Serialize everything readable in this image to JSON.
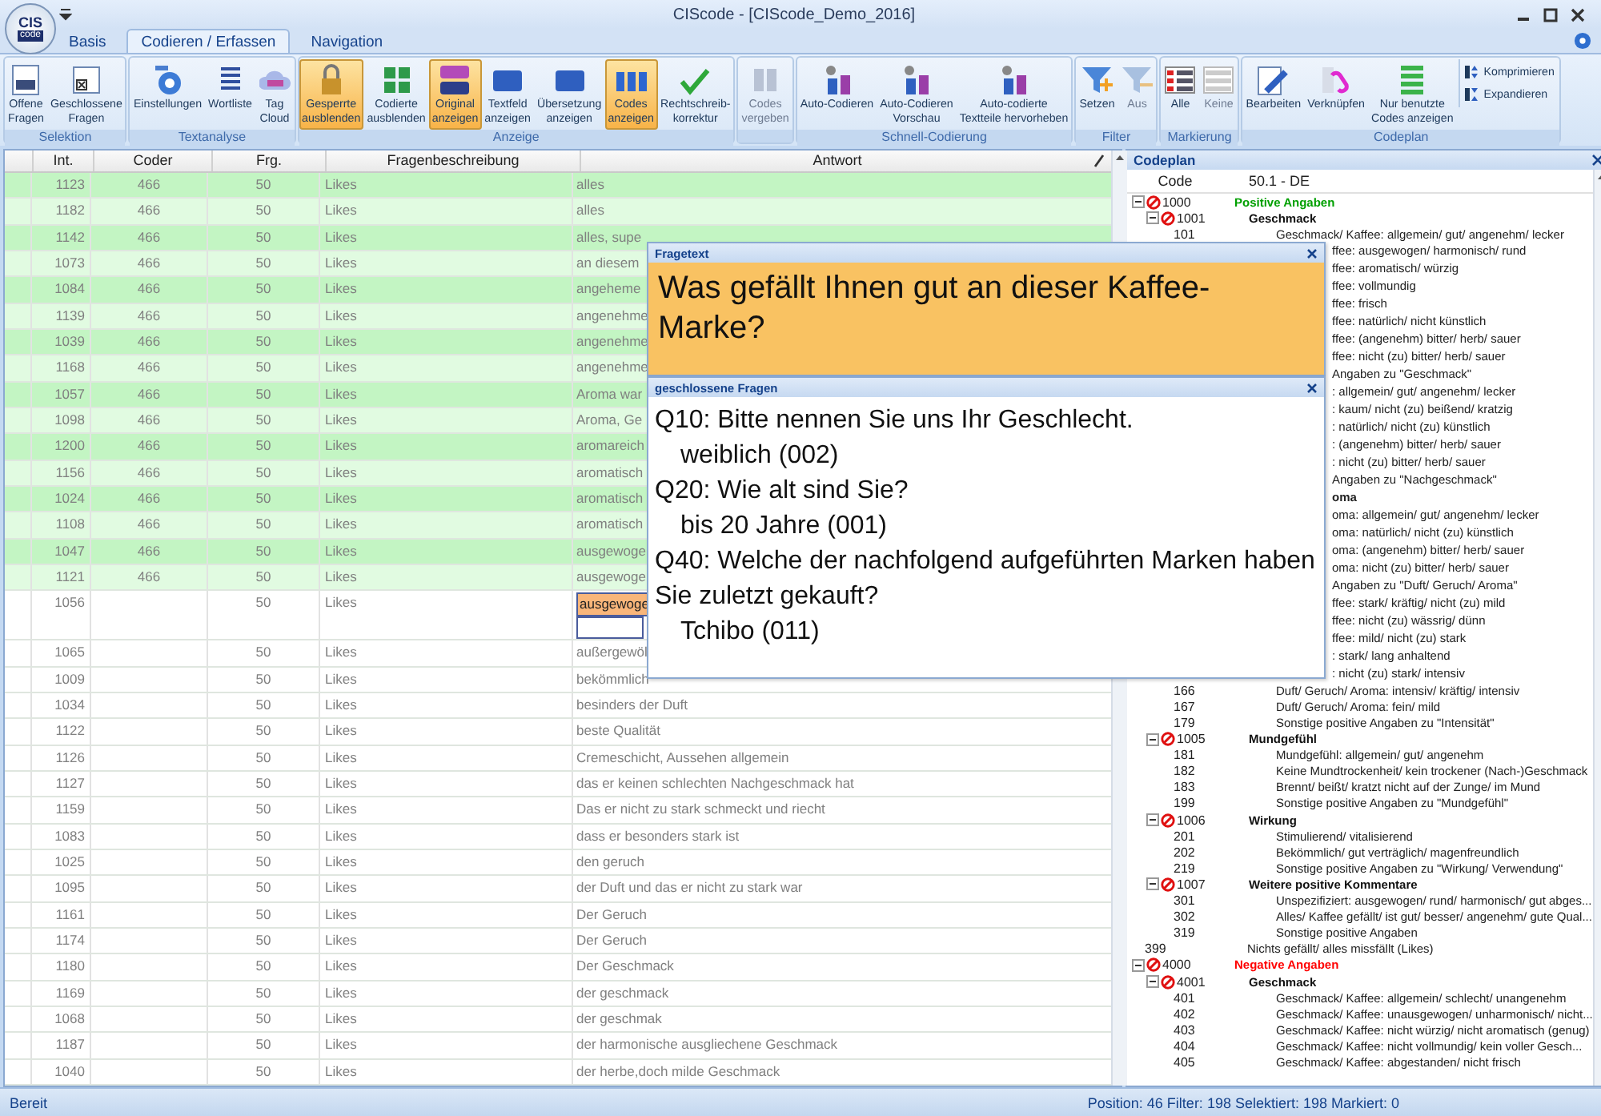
{
  "window": {
    "title": "CIScode - [CIScode_Demo_2016]",
    "logo": [
      "CIS",
      "code"
    ]
  },
  "tabs": [
    {
      "label": "Basis",
      "selected": false
    },
    {
      "label": "Codieren / Erfassen",
      "selected": true
    },
    {
      "label": "Navigation",
      "selected": false
    }
  ],
  "ribbon": [
    {
      "label": "Selektion",
      "buttons": [
        {
          "label": "Offene\nFragen",
          "active": false,
          "disabled": false
        },
        {
          "label": "Geschlossene\nFragen",
          "active": false,
          "disabled": false
        }
      ]
    },
    {
      "label": "Textanalyse",
      "buttons": [
        {
          "label": "Einstellungen",
          "active": false,
          "disabled": false
        },
        {
          "label": "Wortliste",
          "active": false,
          "disabled": false
        },
        {
          "label": "Tag\nCloud",
          "active": false,
          "disabled": false
        }
      ]
    },
    {
      "label": "Anzeige",
      "buttons": [
        {
          "label": "Gesperrte\nausblenden",
          "active": true,
          "disabled": false
        },
        {
          "label": "Codierte\nausblenden",
          "active": false,
          "disabled": false
        },
        {
          "label": "Original\nanzeigen",
          "active": true,
          "disabled": false
        },
        {
          "label": "Textfeld\nanzeigen",
          "active": false,
          "disabled": false
        },
        {
          "label": "Übersetzung\nanzeigen",
          "active": false,
          "disabled": false
        },
        {
          "label": "Codes\nanzeigen",
          "active": true,
          "disabled": false
        },
        {
          "label": "Rechtschreib-\nkorrektur",
          "active": false,
          "disabled": false
        }
      ]
    },
    {
      "buttons": [
        {
          "label": "Codes\nvergeben",
          "active": false,
          "disabled": true
        }
      ]
    },
    {
      "label": "Schnell-Codierung",
      "buttons": [
        {
          "label": "Auto-Codieren",
          "active": false,
          "disabled": false
        },
        {
          "label": "Auto-Codieren\nVorschau",
          "active": false,
          "disabled": false
        },
        {
          "label": "Auto-codierte\nTextteile hervorheben",
          "active": false,
          "disabled": false
        }
      ]
    },
    {
      "label": "Filter",
      "buttons": [
        {
          "label": "Setzen",
          "active": false,
          "disabled": false
        },
        {
          "label": "Aus",
          "active": false,
          "disabled": true
        }
      ]
    },
    {
      "label": "Markierung",
      "buttons": [
        {
          "label": "Alle",
          "active": false,
          "disabled": false
        },
        {
          "label": "Keine",
          "active": false,
          "disabled": true
        }
      ]
    },
    {
      "label": "Codeplan",
      "buttons": [
        {
          "label": "Bearbeiten",
          "active": false,
          "disabled": false
        },
        {
          "label": "Verknüpfen",
          "active": false,
          "disabled": false
        },
        {
          "label": "Nur benutzte\nCodes anzeigen",
          "active": false,
          "disabled": false
        }
      ],
      "small_buttons": [
        "Komprimieren",
        "Expandieren"
      ]
    }
  ],
  "table": {
    "columns": [
      "Int.",
      "Coder",
      "Frg.",
      "Fragenbeschreibung",
      "Antwort"
    ],
    "rows": [
      {
        "int": "1123",
        "coder": "466",
        "frg": "50",
        "desc": "Likes",
        "answer": "alles",
        "coded": true,
        "editing": false
      },
      {
        "int": "1182",
        "coder": "466",
        "frg": "50",
        "desc": "Likes",
        "answer": "alles",
        "coded": true,
        "editing": false
      },
      {
        "int": "1142",
        "coder": "466",
        "frg": "50",
        "desc": "Likes",
        "answer": "alles, supe",
        "coded": true,
        "editing": false
      },
      {
        "int": "1073",
        "coder": "466",
        "frg": "50",
        "desc": "Likes",
        "answer": "an diesem",
        "coded": true,
        "editing": false
      },
      {
        "int": "1084",
        "coder": "466",
        "frg": "50",
        "desc": "Likes",
        "answer": "angeheme",
        "coded": true,
        "editing": false
      },
      {
        "int": "1139",
        "coder": "466",
        "frg": "50",
        "desc": "Likes",
        "answer": "angenehme",
        "coded": true,
        "editing": false
      },
      {
        "int": "1039",
        "coder": "466",
        "frg": "50",
        "desc": "Likes",
        "answer": "angenehme",
        "coded": true,
        "editing": false
      },
      {
        "int": "1168",
        "coder": "466",
        "frg": "50",
        "desc": "Likes",
        "answer": "angenehme",
        "coded": true,
        "editing": false
      },
      {
        "int": "1057",
        "coder": "466",
        "frg": "50",
        "desc": "Likes",
        "answer": "Aroma war",
        "coded": true,
        "editing": false
      },
      {
        "int": "1098",
        "coder": "466",
        "frg": "50",
        "desc": "Likes",
        "answer": "Aroma, Ge",
        "coded": true,
        "editing": false
      },
      {
        "int": "1200",
        "coder": "466",
        "frg": "50",
        "desc": "Likes",
        "answer": "aromareich",
        "coded": true,
        "editing": false
      },
      {
        "int": "1156",
        "coder": "466",
        "frg": "50",
        "desc": "Likes",
        "answer": "aromatisch",
        "coded": true,
        "editing": false
      },
      {
        "int": "1024",
        "coder": "466",
        "frg": "50",
        "desc": "Likes",
        "answer": "aromatisch",
        "coded": true,
        "editing": false
      },
      {
        "int": "1108",
        "coder": "466",
        "frg": "50",
        "desc": "Likes",
        "answer": "aromatisch",
        "coded": true,
        "editing": false
      },
      {
        "int": "1047",
        "coder": "466",
        "frg": "50",
        "desc": "Likes",
        "answer": "ausgewoge",
        "coded": true,
        "editing": false
      },
      {
        "int": "1121",
        "coder": "466",
        "frg": "50",
        "desc": "Likes",
        "answer": "ausgewoge",
        "coded": true,
        "editing": false
      },
      {
        "int": "1056",
        "frg": "50",
        "desc": "Likes",
        "answer": "ausgewoge",
        "coded": false,
        "editing": true
      },
      {
        "int": "1065",
        "frg": "50",
        "desc": "Likes",
        "answer": "außergewöl",
        "coded": false,
        "editing": false
      },
      {
        "int": "1009",
        "frg": "50",
        "desc": "Likes",
        "answer": "bekömmlich",
        "coded": false,
        "editing": false
      },
      {
        "int": "1034",
        "frg": "50",
        "desc": "Likes",
        "answer": "besinders der Duft",
        "coded": false,
        "editing": false
      },
      {
        "int": "1122",
        "frg": "50",
        "desc": "Likes",
        "answer": "beste Qualität",
        "coded": false,
        "editing": false
      },
      {
        "int": "1126",
        "frg": "50",
        "desc": "Likes",
        "answer": "Cremeschicht, Aussehen allgemein",
        "coded": false,
        "editing": false
      },
      {
        "int": "1127",
        "frg": "50",
        "desc": "Likes",
        "answer": "das er keinen schlechten Nachgeschmack hat",
        "coded": false,
        "editing": false
      },
      {
        "int": "1159",
        "frg": "50",
        "desc": "Likes",
        "answer": "Das er nicht zu stark schmeckt und riecht",
        "coded": false,
        "editing": false
      },
      {
        "int": "1083",
        "frg": "50",
        "desc": "Likes",
        "answer": "dass er besonders stark ist",
        "coded": false,
        "editing": false
      },
      {
        "int": "1025",
        "frg": "50",
        "desc": "Likes",
        "answer": "den geruch",
        "coded": false,
        "editing": false
      },
      {
        "int": "1095",
        "frg": "50",
        "desc": "Likes",
        "answer": "der Duft und das er nicht zu stark war",
        "coded": false,
        "editing": false
      },
      {
        "int": "1161",
        "frg": "50",
        "desc": "Likes",
        "answer": "Der Geruch",
        "coded": false,
        "editing": false
      },
      {
        "int": "1174",
        "frg": "50",
        "desc": "Likes",
        "answer": "Der Geruch",
        "coded": false,
        "editing": false
      },
      {
        "int": "1180",
        "frg": "50",
        "desc": "Likes",
        "answer": "Der Geschmack",
        "coded": false,
        "editing": false
      },
      {
        "int": "1169",
        "frg": "50",
        "desc": "Likes",
        "answer": "der geschmack",
        "coded": false,
        "editing": false
      },
      {
        "int": "1068",
        "frg": "50",
        "desc": "Likes",
        "answer": "der geschmak",
        "coded": false,
        "editing": false
      },
      {
        "int": "1187",
        "frg": "50",
        "desc": "Likes",
        "answer": "der harmonische ausgliechene Geschmack",
        "coded": false,
        "editing": false
      },
      {
        "int": "1040",
        "frg": "50",
        "desc": "Likes",
        "answer": "der herbe,doch milde Geschmack",
        "coded": false,
        "editing": false
      }
    ]
  },
  "fragetext": {
    "title": "Fragetext",
    "text": "Was gefällt Ihnen gut an dieser Kaffee-Marke?"
  },
  "closed_questions": {
    "title": "geschlossene Fragen",
    "questions": [
      {
        "text": "Q10: Bitte nennen Sie uns Ihr Geschlecht.",
        "answers": [
          "weiblich (002)"
        ]
      },
      {
        "text": "Q20: Wie alt sind Sie?",
        "answers": [
          "bis 20 Jahre (001)"
        ]
      },
      {
        "text": "Q40: Welche der nachfolgend aufgeführten Marken haben Sie zuletzt gekauft?",
        "answers": [
          "Tchibo (011)"
        ]
      }
    ]
  },
  "codeplan": {
    "title": "Codeplan",
    "columns": [
      "Code",
      "50.1 - DE"
    ],
    "nodes": [
      {
        "kind": "group",
        "code": "1000",
        "label": "Positive Angaben",
        "color": "#00a000",
        "expanded": true,
        "children": [
          {
            "kind": "group",
            "code": "1001",
            "label": "Geschmack",
            "expanded": true,
            "children": [
              {
                "kind": "item",
                "code": "101",
                "label": "Geschmack/ Kaffee: allgemein/ gut/ angenehm/ lecker"
              },
              {
                "kind": "fragment",
                "label": "ffee: ausgewogen/ harmonisch/ rund"
              },
              {
                "kind": "fragment",
                "label": "ffee: aromatisch/ würzig"
              },
              {
                "kind": "fragment",
                "label": "ffee: vollmundig"
              },
              {
                "kind": "fragment",
                "label": "ffee: frisch"
              },
              {
                "kind": "fragment",
                "label": "ffee: natürlich/ nicht künstlich"
              },
              {
                "kind": "fragment",
                "label": "ffee: (angenehm) bitter/ herb/ sauer"
              },
              {
                "kind": "fragment",
                "label": "ffee: nicht (zu) bitter/ herb/ sauer"
              },
              {
                "kind": "fragment",
                "label": "Angaben zu \"Geschmack\""
              }
            ]
          },
          {
            "kind": "fragment",
            "label": ": allgemein/ gut/ angenehm/ lecker"
          },
          {
            "kind": "fragment",
            "label": ": kaum/ nicht (zu) beißend/ kratzig"
          },
          {
            "kind": "fragment",
            "label": ": natürlich/ nicht (zu) künstlich"
          },
          {
            "kind": "fragment",
            "label": ": (angenehm) bitter/ herb/ sauer"
          },
          {
            "kind": "fragment",
            "label": ": nicht (zu) bitter/ herb/ sauer"
          },
          {
            "kind": "fragment",
            "label": "Angaben zu \"Nachgeschmack\""
          },
          {
            "kind": "fragment_heading",
            "label": "oma"
          },
          {
            "kind": "fragment",
            "label": "oma: allgemein/ gut/ angenehm/ lecker"
          },
          {
            "kind": "fragment",
            "label": "oma: natürlich/ nicht (zu) künstlich"
          },
          {
            "kind": "fragment",
            "label": "oma: (angenehm) bitter/ herb/ sauer"
          },
          {
            "kind": "fragment",
            "label": "oma: nicht (zu) bitter/ herb/ sauer"
          },
          {
            "kind": "fragment",
            "label": "Angaben zu \"Duft/ Geruch/ Aroma\""
          },
          {
            "kind": "fragment",
            "label": "ffee: stark/ kräftig/ nicht (zu) mild"
          },
          {
            "kind": "fragment",
            "label": "ffee: nicht (zu) wässrig/ dünn"
          },
          {
            "kind": "fragment",
            "label": "ffee: mild/ nicht (zu) stark"
          },
          {
            "kind": "fragment",
            "label": ": stark/ lang anhaltend"
          },
          {
            "kind": "fragment",
            "label": ": nicht (zu) stark/ intensiv"
          },
          {
            "kind": "item",
            "code": "166",
            "label": "Duft/ Geruch/ Aroma: intensiv/ kräftig/ intensiv"
          },
          {
            "kind": "item",
            "code": "167",
            "label": "Duft/ Geruch/ Aroma: fein/ mild"
          },
          {
            "kind": "item",
            "code": "179",
            "label": "Sonstige positive Angaben zu \"Intensität\""
          },
          {
            "kind": "group",
            "code": "1005",
            "label": "Mundgefühl",
            "expanded": true,
            "children": [
              {
                "kind": "item",
                "code": "181",
                "label": "Mundgefühl: allgemein/ gut/ angenehm"
              },
              {
                "kind": "item",
                "code": "182",
                "label": "Keine Mundtrockenheit/ kein trockener (Nach-)Geschmack"
              },
              {
                "kind": "item",
                "code": "183",
                "label": "Brennt/ beißt/ kratzt nicht auf der Zunge/ im Mund"
              },
              {
                "kind": "item",
                "code": "199",
                "label": "Sonstige positive Angaben zu \"Mundgefühl\""
              }
            ]
          },
          {
            "kind": "group",
            "code": "1006",
            "label": "Wirkung",
            "expanded": true,
            "children": [
              {
                "kind": "item",
                "code": "201",
                "label": "Stimulierend/ vitalisierend"
              },
              {
                "kind": "item",
                "code": "202",
                "label": "Bekömmlich/ gut verträglich/ magenfreundlich"
              },
              {
                "kind": "item",
                "code": "219",
                "label": "Sonstige positive Angaben zu \"Wirkung/ Verwendung\""
              }
            ]
          },
          {
            "kind": "group",
            "code": "1007",
            "label": "Weitere positive Kommentare",
            "expanded": true,
            "children": [
              {
                "kind": "item",
                "code": "301",
                "label": "Unspezifiziert: ausgewogen/ rund/ harmonisch/ gut abges..."
              },
              {
                "kind": "item",
                "code": "302",
                "label": "Alles/ Kaffee gefällt/ ist gut/ besser/ angenehm/ gute Qual..."
              },
              {
                "kind": "item",
                "code": "319",
                "label": "Sonstige positive Angaben"
              }
            ]
          }
        ]
      },
      {
        "kind": "item",
        "code": "399",
        "label": "Nichts gefällt/ alles missfällt (Likes)"
      },
      {
        "kind": "group",
        "code": "4000",
        "label": "Negative Angaben",
        "color": "#ff0000",
        "expanded": true,
        "children": [
          {
            "kind": "group",
            "code": "4001",
            "label": "Geschmack",
            "expanded": true,
            "children": [
              {
                "kind": "item",
                "code": "401",
                "label": "Geschmack/ Kaffee: allgemein/ schlecht/ unangenehm"
              },
              {
                "kind": "item",
                "code": "402",
                "label": "Geschmack/ Kaffee: unausgewogen/ unharmonisch/ nicht..."
              },
              {
                "kind": "item",
                "code": "403",
                "label": "Geschmack/ Kaffee: nicht würzig/ nicht aromatisch (genug)"
              },
              {
                "kind": "item",
                "code": "404",
                "label": "Geschmack/ Kaffee: nicht vollmundig/ kein voller Gesch..."
              },
              {
                "kind": "item",
                "code": "405",
                "label": "Geschmack/ Kaffee: abgestanden/ nicht frisch"
              }
            ]
          }
        ]
      }
    ]
  },
  "status_bar": {
    "left": "Bereit",
    "right": "Position: 46 Filter: 198 Selektiert: 198 Markiert: 0"
  }
}
